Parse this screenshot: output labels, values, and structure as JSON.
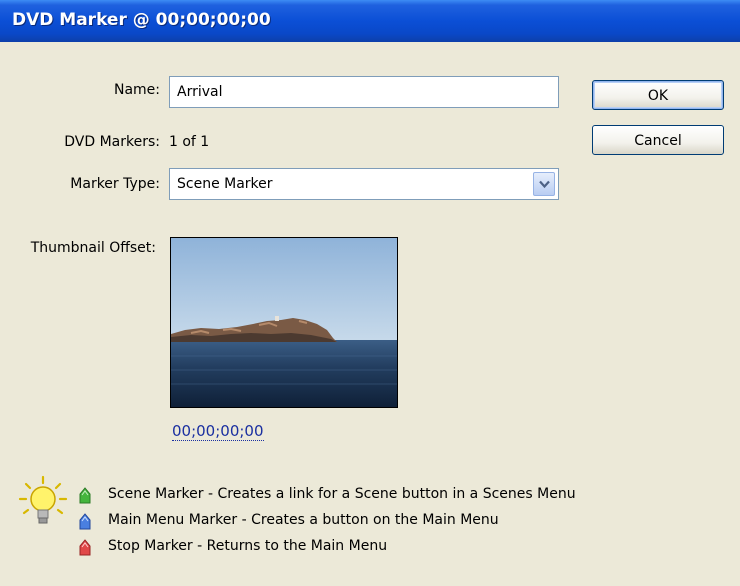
{
  "window": {
    "title": "DVD Marker @ 00;00;00;00"
  },
  "form": {
    "name_label": "Name:",
    "name_value": "Arrival",
    "markers_label": "DVD Markers:",
    "markers_value": "1 of 1",
    "type_label": "Marker Type:",
    "type_value": "Scene Marker",
    "thumb_label": "Thumbnail Offset:",
    "thumb_timecode": "00;00;00;00"
  },
  "buttons": {
    "ok": "OK",
    "cancel": "Cancel"
  },
  "legend": {
    "items": [
      {
        "text": "Scene Marker - Creates a link for a Scene button in a Scenes Menu",
        "color": "#3aa635",
        "icon": "green-marker-icon"
      },
      {
        "text": "Main Menu Marker - Creates a button on the Main Menu",
        "color": "#3b6fd9",
        "icon": "blue-marker-icon"
      },
      {
        "text": "Stop Marker - Returns to the Main Menu",
        "color": "#d93a3a",
        "icon": "red-marker-icon"
      }
    ]
  },
  "colors": {
    "titlebar": "#0b4fd6",
    "dialog_bg": "#ece9d8",
    "link": "#1a2fa0"
  }
}
